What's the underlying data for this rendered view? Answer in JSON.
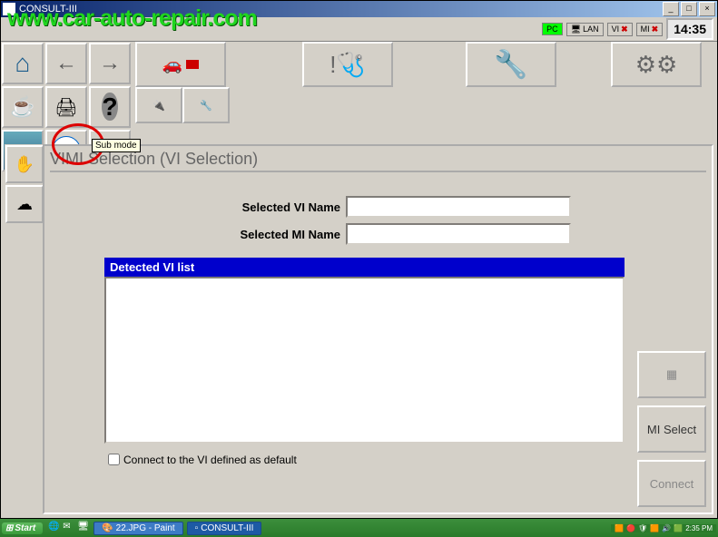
{
  "window": {
    "title": "CONSULT-III"
  },
  "watermark": "www.car-auto-repair.com",
  "statusBar": {
    "pc": "PC",
    "lan": "LAN",
    "vi": "VI",
    "mi": "MI",
    "clock": "14:35"
  },
  "tooltip": "Sub mode",
  "subBtn": "SUB",
  "page": {
    "title": "VIMI Selection (VI Selection)",
    "labels": {
      "selectedVI": "Selected VI Name",
      "selectedMI": "Selected MI Name"
    },
    "values": {
      "selectedVI": "",
      "selectedMI": ""
    },
    "listHeader": "Detected VI list",
    "checkboxLabel": "Connect to the VI defined as default"
  },
  "buttons": {
    "icon": "",
    "miSelect": "MI Select",
    "connect": "Connect"
  },
  "taskbar": {
    "start": "Start",
    "items": [
      {
        "label": "22.JPG - Paint"
      },
      {
        "label": "CONSULT-III"
      }
    ],
    "time": "2:35 PM"
  }
}
